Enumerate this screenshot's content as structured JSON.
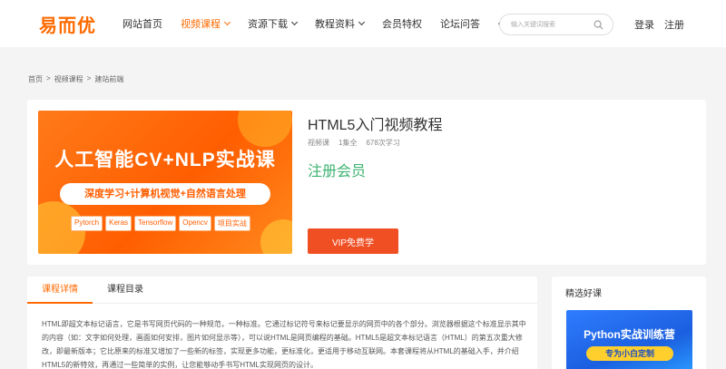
{
  "logo": "易而优",
  "nav": [
    {
      "label": "网站首页",
      "active": false,
      "dropdown": false
    },
    {
      "label": "视频课程",
      "active": true,
      "dropdown": true
    },
    {
      "label": "资源下载",
      "active": false,
      "dropdown": true
    },
    {
      "label": "教程资料",
      "active": false,
      "dropdown": true
    },
    {
      "label": "会员特权",
      "active": false,
      "dropdown": false
    },
    {
      "label": "论坛问答",
      "active": false,
      "dropdown": false
    }
  ],
  "nav_more": "•••",
  "search": {
    "placeholder": "输入关键词搜索",
    "icon": "search-icon"
  },
  "auth": {
    "login": "登录",
    "register": "注册"
  },
  "breadcrumb": [
    "首页",
    "视频课程",
    "建站前端"
  ],
  "breadcrumb_sep": ">",
  "course": {
    "banner": {
      "title": "人工智能CV+NLP实战课",
      "subtitle": "深度学习+计算机视觉+自然语言处理",
      "tags": [
        "Pytorch",
        "Keras",
        "Tensorflow",
        "Opencv",
        "项目实战"
      ]
    },
    "title": "HTML5入门视频教程",
    "type": "视频课",
    "episodes": "1集全",
    "learners": "678次学习",
    "member_label": "注册会员",
    "vip_button": "VIP免费学"
  },
  "detail": {
    "tabs": [
      {
        "label": "课程详情",
        "active": true
      },
      {
        "label": "课程目录",
        "active": false
      }
    ],
    "description": "HTML即超文本标记语言，它是书写网页代码的一种规范，一种标准。它通过标记符号来标记要显示的网页中的各个部分。浏览器根据这个标准显示其中的内容（如：文字如何处理，画面如何安排，图片如何显示等），可以说HTML是网页编程的基础。HTML5是超文本标记语言（HTML）的第五次重大修改，即最新版本；它比原来的标准又增加了一些新的标签，实现更多功能，更标准化，更适用于移动互联网。本套课程将从HTML的基础入手，并介绍HTML5的新特效，再通过一些简单的实例，让您能够动手书写HTML实现网页的设计。"
  },
  "side": {
    "title": "精选好课",
    "banner_title": "Python实战训练营",
    "banner_sub": "专为小白定制"
  },
  "colors": {
    "accent": "#ff6a00",
    "vip": "#f04e23",
    "member": "#3cb371",
    "side_banner": "#1b5fe0"
  }
}
